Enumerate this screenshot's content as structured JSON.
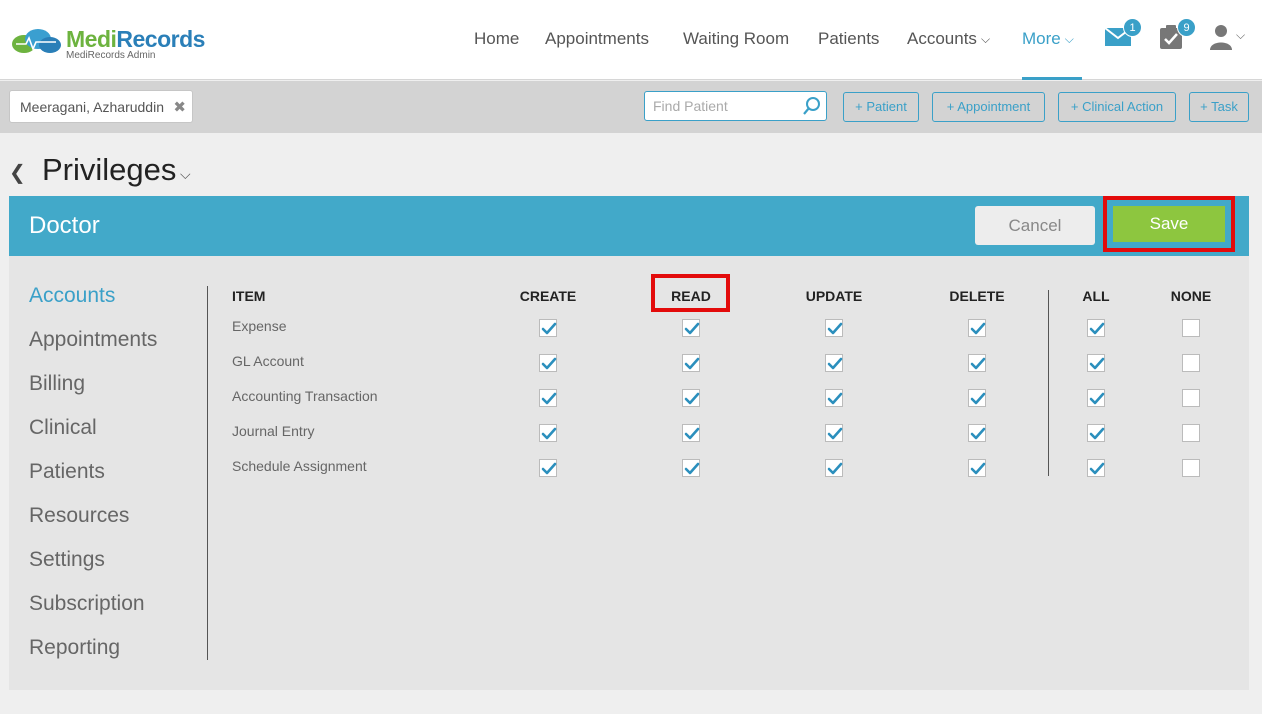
{
  "brand": {
    "name_part1": "Medi",
    "name_part2": "Records",
    "subtitle": "MediRecords Admin"
  },
  "nav": {
    "home": "Home",
    "appointments": "Appointments",
    "waiting_room": "Waiting Room",
    "patients": "Patients",
    "accounts": "Accounts",
    "more": "More",
    "messages_badge": "1",
    "tasks_badge": "9"
  },
  "patient_bar": {
    "patient_name": "Meeragani, Azharuddin",
    "find_placeholder": "Find Patient",
    "add_patient": "+ Patient",
    "add_appointment": "+ Appointment",
    "add_clinical_action": "+ Clinical Action",
    "add_task": "+ Task"
  },
  "page": {
    "title": "Privileges"
  },
  "card": {
    "role": "Doctor",
    "cancel": "Cancel",
    "save": "Save"
  },
  "categories": [
    "Accounts",
    "Appointments",
    "Billing",
    "Clinical",
    "Patients",
    "Resources",
    "Settings",
    "Subscription",
    "Reporting"
  ],
  "columns": {
    "item": "ITEM",
    "create": "CREATE",
    "read": "READ",
    "update": "UPDATE",
    "delete": "DELETE",
    "all": "ALL",
    "none": "NONE"
  },
  "rows": [
    {
      "label": "Expense",
      "create": true,
      "read": true,
      "update": true,
      "delete": true,
      "all": true,
      "none": false
    },
    {
      "label": "GL Account",
      "create": true,
      "read": true,
      "update": true,
      "delete": true,
      "all": true,
      "none": false
    },
    {
      "label": "Accounting Transaction",
      "create": true,
      "read": true,
      "update": true,
      "delete": true,
      "all": true,
      "none": false
    },
    {
      "label": "Journal Entry",
      "create": true,
      "read": true,
      "update": true,
      "delete": true,
      "all": true,
      "none": false
    },
    {
      "label": "Schedule Assignment",
      "create": true,
      "read": true,
      "update": true,
      "delete": true,
      "all": true,
      "none": false
    }
  ],
  "colors": {
    "accent": "#42a9c9",
    "save_green": "#8dc63f",
    "highlight_red": "#e30b0b"
  }
}
